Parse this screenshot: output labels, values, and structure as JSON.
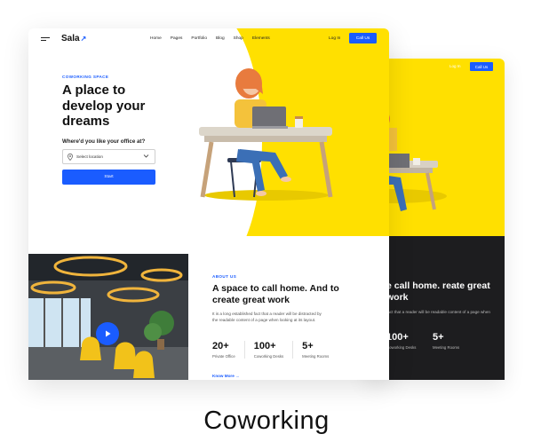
{
  "front": {
    "nav": {
      "logo": "Sala",
      "logo_mark": "↗",
      "links": [
        "Home",
        "Pages",
        "Portfolio",
        "Blog",
        "Shop",
        "Elements"
      ],
      "login": "Log In",
      "call": "Call Us"
    },
    "hero": {
      "eyebrow": "COWORKING SPACE",
      "title": "A place to develop your dreams",
      "question": "Where'd you like your office at?",
      "select_placeholder": "Select location",
      "start": "Start"
    },
    "about": {
      "eyebrow": "ABOUT US",
      "title": "A space to call home. And to create great work",
      "paragraph": "It is a long established fact that a reader will be distracted by the readable content of a page when looking at its layout.",
      "stats": [
        {
          "value": "20+",
          "label": "Private Office"
        },
        {
          "value": "100+",
          "label": "Coworking Desks"
        },
        {
          "value": "5+",
          "label": "Meeting Rooms"
        }
      ],
      "link": "Know More"
    }
  },
  "back": {
    "login": "Log In",
    "call": "Call Us",
    "heading": "e call home. reate great work",
    "paragraph": "fact that a reader will be readable content of a page when",
    "stats": [
      {
        "value": "100+",
        "label": "Coworking Desks"
      },
      {
        "value": "5+",
        "label": "Meeting Rooms"
      }
    ]
  },
  "caption": "Coworking",
  "colors": {
    "accent": "#1a5cff",
    "yellow": "#ffe000",
    "dark": "#1d1d1f"
  }
}
